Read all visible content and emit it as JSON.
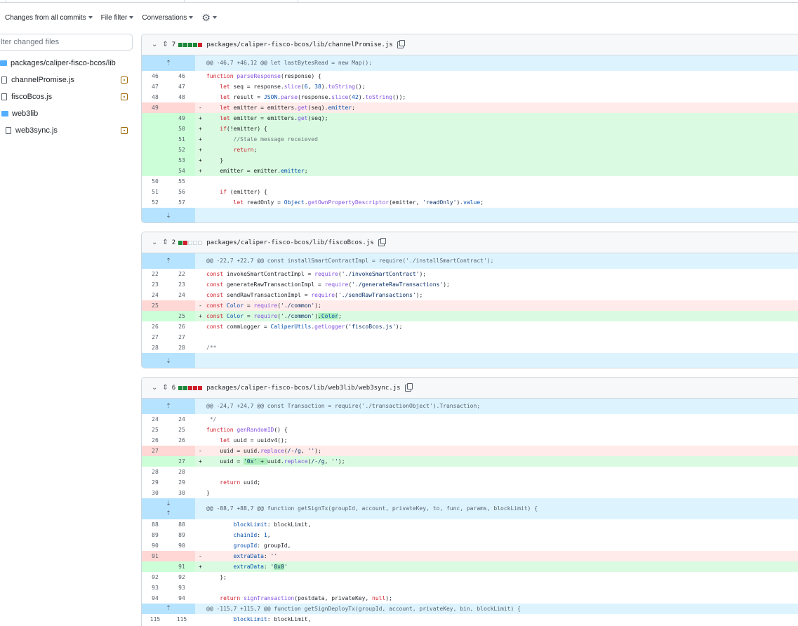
{
  "toolbar": {
    "changes_label": "Changes from all commits",
    "file_filter_label": "File filter",
    "conversations_label": "Conversations"
  },
  "filter": {
    "placeholder": "Filter changed files",
    "visible_text": "lter changed files"
  },
  "tree": {
    "folder_path": "packages/caliper-fisco-bcos/lib",
    "files": [
      "channelPromise.js",
      "fiscoBcos.js",
      "web3lib",
      "web3sync.js"
    ]
  },
  "files": [
    {
      "count": "7",
      "path": "packages/caliper-fisco-bcos/lib/channelPromise.js",
      "hunk": "@@ -46,7 +46,12 @@ let lastBytesRead = new Map();"
    },
    {
      "count": "2",
      "path": "packages/caliper-fisco-bcos/lib/fiscoBcos.js",
      "hunk": "@@ -22,7 +22,7 @@ const installSmartContractImpl = require('./installSmartContract');"
    },
    {
      "count": "6",
      "path": "packages/caliper-fisco-bcos/lib/web3lib/web3sync.js",
      "hunk": "@@ -24,7 +24,7 @@ const Transaction = require('./transactionObject').Transaction;",
      "hunk2": "@@ -88,7 +88,7 @@ function getSignTx(groupId, account, privateKey, to, func, params, blockLimit) {",
      "hunk3": "@@ -115,7 +115,7 @@ function getSignDeployTx(groupId, account, privateKey, bin, blockLimit) {"
    }
  ],
  "colors": {
    "add": "#dafbe1",
    "del": "#ffebe9",
    "hunk": "#ddf4ff",
    "accent": "#1f883d",
    "danger": "#cf222e"
  }
}
